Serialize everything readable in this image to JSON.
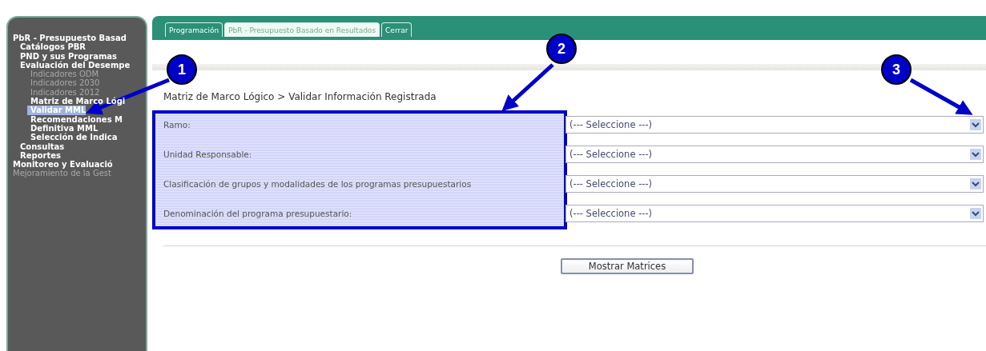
{
  "sidebar": {
    "items": [
      {
        "label": "PbR - Presupuesto Basad",
        "disabled": false,
        "selected": false,
        "children": [
          {
            "label": "Catálogos PBR",
            "disabled": false,
            "selected": false
          },
          {
            "label": "PND y sus Programas",
            "disabled": false,
            "selected": false
          },
          {
            "label": "Evaluación del Desempe",
            "disabled": false,
            "selected": false,
            "children": [
              {
                "label": "Indicadores ODM",
                "disabled": true,
                "selected": false
              },
              {
                "label": "Indicadores 2030",
                "disabled": true,
                "selected": false
              },
              {
                "label": "Indicadores 2012",
                "disabled": true,
                "selected": false
              },
              {
                "label": "Matriz de Marco Lógi",
                "disabled": false,
                "selected": false
              },
              {
                "label": "Validar MML",
                "disabled": false,
                "selected": true
              },
              {
                "label": "Recomendaciones M",
                "disabled": false,
                "selected": false
              },
              {
                "label": "Definitiva MML",
                "disabled": false,
                "selected": false
              },
              {
                "label": "Selección de Indica",
                "disabled": false,
                "selected": false
              }
            ]
          },
          {
            "label": "Consultas",
            "disabled": false,
            "selected": false
          },
          {
            "label": "Reportes",
            "disabled": false,
            "selected": false
          }
        ]
      },
      {
        "label": "Monitoreo y Evaluació",
        "disabled": false,
        "selected": false
      },
      {
        "label": "Mejoramiento de la Gest",
        "disabled": true,
        "selected": false
      }
    ]
  },
  "tabs": [
    {
      "label": "Programación",
      "selected": false
    },
    {
      "label": "PbR - Presupuesto Basado en Resultados",
      "selected": true
    },
    {
      "label": "Cerrar",
      "selected": false
    }
  ],
  "breadcrumb": "Matriz de Marco Lógico > Validar Información Registrada",
  "form": {
    "fields": [
      {
        "label": "Ramo:",
        "value": "(--- Seleccione ---)"
      },
      {
        "label": "Unidad Responsable:",
        "value": "(--- Seleccione ---)"
      },
      {
        "label": "Clasificación de grupos y modalidades de los programas presupuestarios",
        "value": "(--- Seleccione ---)"
      },
      {
        "label": "Denominación del programa presupuestario:",
        "value": "(--- Seleccione ---)"
      }
    ],
    "button": "Mostrar Matrices"
  },
  "callouts": [
    {
      "label": "1"
    },
    {
      "label": "2"
    },
    {
      "label": "3"
    }
  ]
}
